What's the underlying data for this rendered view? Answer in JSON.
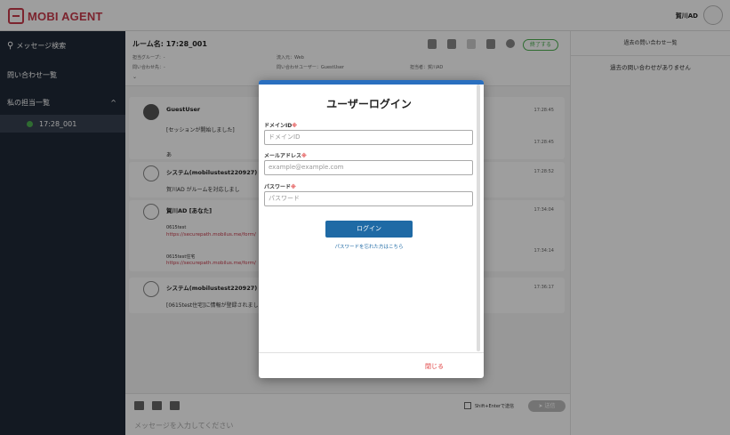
{
  "header": {
    "logo_text": "MOBI AGENT",
    "user_name": "賀川AD"
  },
  "sidebar": {
    "search": "メッセージ検索",
    "inquiry_list": "問い合わせ一覧",
    "my_list": "私の担当一覧",
    "room": "17:28_001"
  },
  "room": {
    "title": "ルーム名: 17:28_001",
    "group_label": "担当グループ：-",
    "inquiry_label": "問い合わせ先：-",
    "channel_label": "流入元：Web",
    "user_label": "問い合わせユーザー：GuestUser",
    "owner_label": "担当者：賀川AD",
    "end_button": "終了する"
  },
  "history": {
    "title": "過去の問い合わせ一覧",
    "empty": "過去の問い合わせがありません"
  },
  "messages": {
    "m1_name": "GuestUser",
    "m1_text": "[セッションが開始しました]",
    "m1_time": "17:28:45",
    "m2_text": "あ",
    "m2_time": "17:28:45",
    "m3_name": "システム(mobilustest220927)",
    "m3_text": "賀川AD がルームを対応しまし",
    "m3_time": "17:28:52",
    "m4_name": "賀川AD [あなた]",
    "m4_time": "17:34:04",
    "m4_line1": "0615test",
    "m4_link1": "https://securepath.mobilus.me/form/",
    "m4_line2": "0615test住宅",
    "m4_link2": "https://securepath.mobilus.me/form/",
    "m4_time2": "17:34:14",
    "m5_name": "システム(mobilustest220927)",
    "m5_text": "[0615test住宅]に情報が登録されまし",
    "m5_time": "17:36:17"
  },
  "input": {
    "shift_label": "Shift+Enterで送信",
    "send": "送信",
    "placeholder": "メッセージを入力してください"
  },
  "modal": {
    "title": "ユーザーログイン",
    "domain_label": "ドメインID",
    "domain_placeholder": "ドメインID",
    "email_label": "メールアドレス",
    "email_placeholder": "example@example.com",
    "password_label": "パスワード",
    "password_placeholder": "パスワード",
    "required_mark": "※",
    "login_button": "ログイン",
    "forgot_link": "パスワードを忘れた方はこちら",
    "close_button": "閉じる"
  },
  "colors": {
    "brand": "#c83a4b",
    "sidebar": "#1f2937",
    "primary": "#1f6aa5",
    "accent_green": "#4caf50"
  }
}
